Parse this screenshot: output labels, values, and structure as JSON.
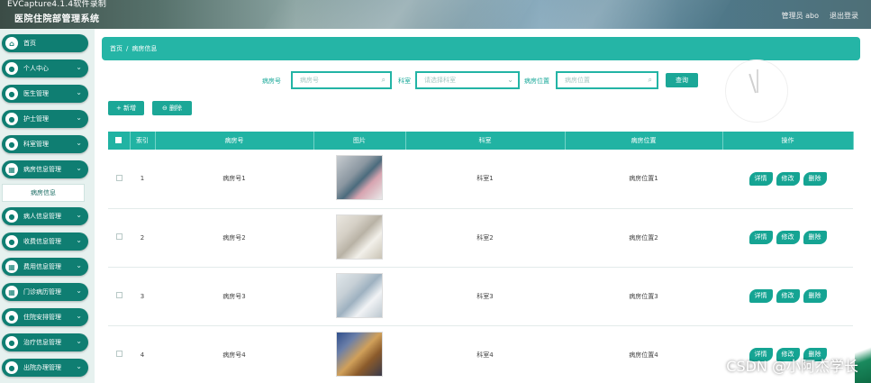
{
  "header": {
    "capture_label": "EVCapture4.1.4软件录制",
    "app_title": "医院住院部管理系统",
    "admin_label": "管理员 abo",
    "logout_label": "退出登录"
  },
  "sidebar": {
    "items": [
      {
        "label": "首页",
        "icon": "home-icon",
        "glyph": "⌂"
      },
      {
        "label": "个人中心",
        "icon": "person-icon",
        "glyph": "●"
      },
      {
        "label": "医生管理",
        "icon": "doctor-icon",
        "glyph": "●"
      },
      {
        "label": "护士管理",
        "icon": "nurse-icon",
        "glyph": "●"
      },
      {
        "label": "科室管理",
        "icon": "department-icon",
        "glyph": "●"
      },
      {
        "label": "病房信息管理",
        "icon": "grid-icon",
        "glyph": "▦"
      },
      {
        "label": "病人信息管理",
        "icon": "patient-icon",
        "glyph": "●"
      },
      {
        "label": "收费信息管理",
        "icon": "fee-icon",
        "glyph": "●"
      },
      {
        "label": "费用信息管理",
        "icon": "cost-icon",
        "glyph": "▦"
      },
      {
        "label": "门诊病历管理",
        "icon": "record-icon",
        "glyph": "▦"
      },
      {
        "label": "住院安排管理",
        "icon": "bed-icon",
        "glyph": "●"
      },
      {
        "label": "治疗信息管理",
        "icon": "treatment-icon",
        "glyph": "●"
      },
      {
        "label": "出院办理管理",
        "icon": "discharge-icon",
        "glyph": "●"
      }
    ],
    "sub_item": "病房信息"
  },
  "breadcrumb": {
    "home": "首页",
    "separator": "/",
    "current": "病房信息"
  },
  "search": {
    "room_label": "病房号",
    "room_placeholder": "病房号",
    "dept_label": "科室",
    "dept_placeholder": "请选择科室",
    "location_label": "病房位置",
    "location_placeholder": "病房位置",
    "query_button": "查询"
  },
  "actions": {
    "add_button": "+ 新增",
    "delete_button": "⊖ 删除"
  },
  "table": {
    "headers": [
      "",
      "索引",
      "病房号",
      "图片",
      "科室",
      "病房位置",
      "操作"
    ],
    "rows": [
      {
        "index": "1",
        "room": "病房号1",
        "dept": "科室1",
        "location": "病房位置1"
      },
      {
        "index": "2",
        "room": "病房号2",
        "dept": "科室2",
        "location": "病房位置2"
      },
      {
        "index": "3",
        "room": "病房号3",
        "dept": "科室3",
        "location": "病房位置3"
      },
      {
        "index": "4",
        "room": "病房号4",
        "dept": "科室4",
        "location": "病房位置4"
      }
    ],
    "op_labels": {
      "detail": "详情",
      "edit": "修改",
      "delete": "删除"
    }
  },
  "watermark": "CSDN @小阿杰学长",
  "colors": {
    "primary": "#1ba797",
    "sidebar": "#0f7e72",
    "header_bg": "#56716b"
  }
}
